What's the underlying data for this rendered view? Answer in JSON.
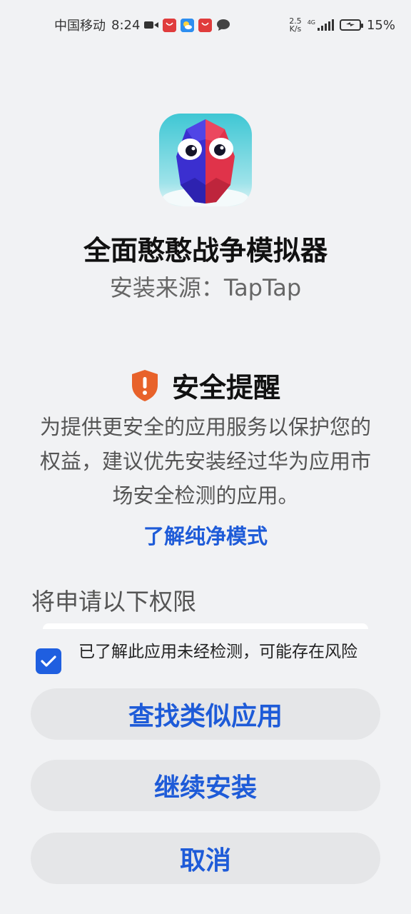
{
  "status_bar": {
    "carrier": "中国移动",
    "time": "8:24",
    "net_speed_value": "2.5",
    "net_speed_unit": "K/s",
    "network_type": "4G",
    "battery_percent": "15%",
    "notification_icons": [
      "video-camera-icon",
      "huawei-appgallery-icon",
      "weather-icon",
      "huawei-appgallery-icon",
      "chat-bubble-icon"
    ],
    "battery_level": 0.15
  },
  "app": {
    "name": "全面憨憨战争模拟器",
    "source": "安装来源：TapTap",
    "icon": "blob-character-app-icon"
  },
  "security": {
    "title": "安全提醒",
    "icon": "shield-warning-icon",
    "body": "为提供更安全的应用服务以保护您的权益，建议优先安装经过华为应用市场安全检测的应用。",
    "learn_more": "了解纯净模式"
  },
  "permissions": {
    "title": "将申请以下权限"
  },
  "acknowledgement": {
    "checked": true,
    "text": "已了解此应用未经检测，可能存在风险"
  },
  "buttons": {
    "find_similar": "查找类似应用",
    "continue_install": "继续安装",
    "cancel": "取消"
  },
  "colors": {
    "accent": "#1e5bd8",
    "background": "#f1f2f4",
    "button_bg": "#e5e6e8",
    "shield": "#e8622a",
    "checkbox": "#1f5fe0"
  }
}
